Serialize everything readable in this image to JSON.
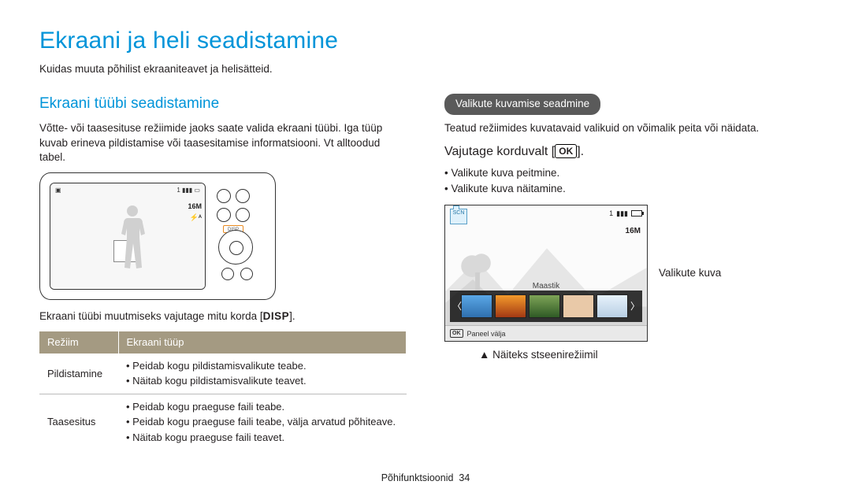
{
  "page": {
    "title": "Ekraani ja heli seadistamine",
    "intro": "Kuidas muuta põhilist ekraaniteavet ja helisätteid."
  },
  "left": {
    "heading": "Ekraani tüübi seadistamine",
    "body": "Võtte- või taasesituse režiimide jaoks saate valida ekraani tüübi. Iga tüüp kuvab erineva pildistamise või taasesitamise informatsiooni. Vt alltoodud tabel.",
    "disp_line_pre": "Ekraani tüübi muutmiseks vajutage mitu korda [",
    "disp_key": "DISP",
    "disp_line_post": "].",
    "lcd_res": "16M",
    "table": {
      "h1": "Režiim",
      "h2": "Ekraani tüüp",
      "rows": [
        {
          "mode": "Pildistamine",
          "items": [
            "Peidab kogu pildistamisvalikute teabe.",
            "Näitab kogu pildistamisvalikute teavet."
          ]
        },
        {
          "mode": "Taasesitus",
          "items": [
            "Peidab kogu praeguse faili teabe.",
            "Peidab kogu praeguse faili teabe, välja arvatud põhiteave.",
            "Näitab kogu praeguse faili teavet."
          ]
        }
      ]
    }
  },
  "right": {
    "pill": "Valikute kuvamise seadmine",
    "body": "Teatud režiimides kuvatavaid valikuid on võimalik peita või näidata.",
    "press_pre": "Vajutage korduvalt [",
    "press_ok": "OK",
    "press_post": "].",
    "bullets": [
      "Valikute kuva peitmine.",
      "Valikute kuva näitamine."
    ],
    "scene": {
      "scn": "SCN",
      "counter": "1",
      "res": "16M",
      "landscape_label": "Maastik",
      "panel_ok": "OK",
      "panel_text": "Paneel välja"
    },
    "caption": "Valikute kuva",
    "example": "▲ Näiteks stseenirežiimil"
  },
  "footer": {
    "section": "Põhifunktsioonid",
    "page_no": "34"
  }
}
